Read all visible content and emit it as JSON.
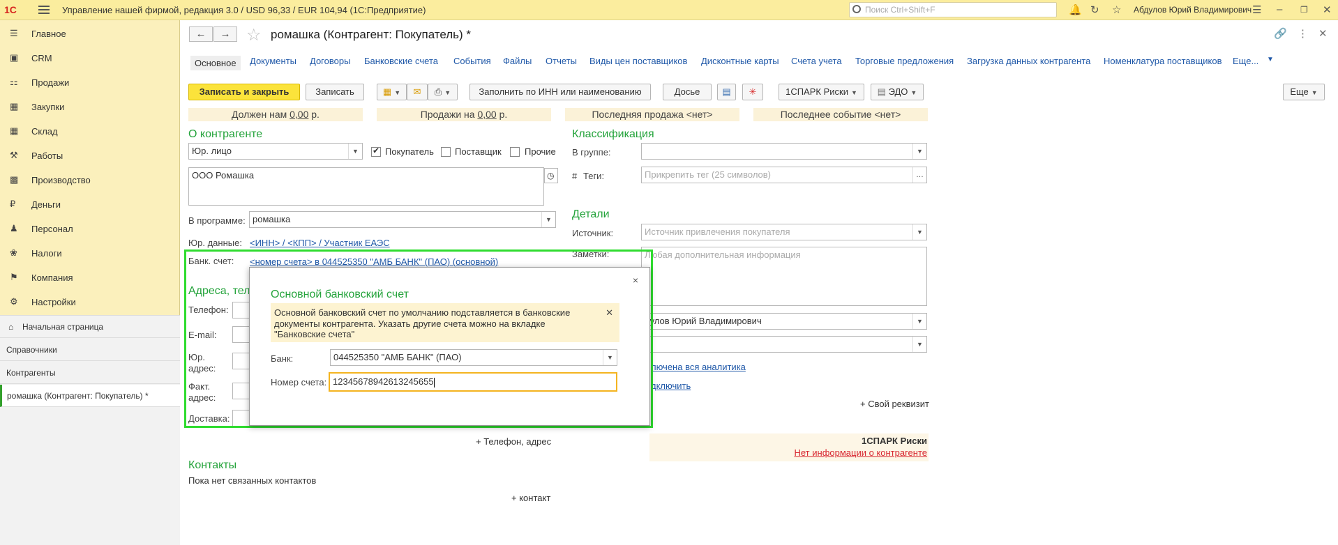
{
  "topbar": {
    "logo": "1С",
    "app_title": "Управление нашей фирмой, редакция 3.0 / USD 96,33 / EUR 104,94  (1С:Предприятие)",
    "search_placeholder": "Поиск Ctrl+Shift+F",
    "user": "Абдулов Юрий Владимирович"
  },
  "sidebar": {
    "sections": [
      {
        "label": "Главное",
        "icon": "menu-icon"
      },
      {
        "label": "CRM",
        "icon": "crm-icon"
      },
      {
        "label": "Продажи",
        "icon": "basket-icon"
      },
      {
        "label": "Закупки",
        "icon": "purchases-icon"
      },
      {
        "label": "Склад",
        "icon": "warehouse-icon"
      },
      {
        "label": "Работы",
        "icon": "tools-icon"
      },
      {
        "label": "Производство",
        "icon": "factory-icon"
      },
      {
        "label": "Деньги",
        "icon": "ruble-icon"
      },
      {
        "label": "Персонал",
        "icon": "people-icon"
      },
      {
        "label": "Налоги",
        "icon": "emblem-icon"
      },
      {
        "label": "Компания",
        "icon": "flag-icon"
      },
      {
        "label": "Настройки",
        "icon": "gear-icon"
      }
    ],
    "open_windows": [
      {
        "label": "Начальная страница"
      },
      {
        "label": "Справочники"
      },
      {
        "label": "Контрагенты"
      },
      {
        "label": "ромашка (Контрагент: Покупатель) *"
      }
    ]
  },
  "header": {
    "back": "←",
    "forward": "→",
    "title": "ромашка (Контрагент: Покупатель) *"
  },
  "tabs": [
    "Основное",
    "Документы",
    "Договоры",
    "Банковские счета",
    "События",
    "Файлы",
    "Отчеты",
    "Виды цен поставщиков",
    "Дисконтные карты",
    "Счета учета",
    "Торговые предложения",
    "Загрузка данных контрагента",
    "Номенклатура поставщиков",
    "Еще..."
  ],
  "toolbar": {
    "save_close": "Записать и закрыть",
    "save": "Записать",
    "fill_inn": "Заполнить по ИНН или наименованию",
    "dossier": "Досье",
    "spark": "1СПАРК Риски",
    "edo": "ЭДО",
    "more": "Еще"
  },
  "summary": {
    "owes_label": "Должен нам",
    "owes_value": "0,00",
    "sales_label": "Продажи на",
    "sales_value": "0,00",
    "currency": "р.",
    "last_sale": "Последняя продажа <нет>",
    "last_event": "Последнее событие <нет>"
  },
  "about": {
    "title": "О контрагенте",
    "entity_type": "Юр. лицо",
    "cb_buyer": "Покупатель",
    "cb_supplier": "Поставщик",
    "cb_other": "Прочие",
    "full_name": "ООО Ромашка",
    "in_program_label": "В программе:",
    "in_program_value": "ромашка",
    "legal_label": "Юр. данные:",
    "legal_link": "<ИНН> / <КПП> / Участник ЕАЭС",
    "bank_label": "Банк. счет:",
    "bank_link": "<номер счета> в 044525350 \"АМБ БАНК\" (ПАО) (основной)"
  },
  "addresses": {
    "title": "Адреса, тел",
    "phone": "Телефон:",
    "email": "E-mail:",
    "legal_addr_1": "Юр.",
    "legal_addr_2": "адрес:",
    "fact_addr_1": "Факт.",
    "fact_addr_2": "адрес:",
    "delivery": "Доставка:",
    "add_phone": "+ Телефон, адрес"
  },
  "contacts": {
    "title": "Контакты",
    "empty": "Пока нет связанных контактов",
    "add": "+ контакт"
  },
  "classification": {
    "title": "Классификация",
    "group_label": "В группе:",
    "tags_hash": "#",
    "tags_label": "Теги:",
    "tags_placeholder": "Прикрепить тег (25 символов)"
  },
  "details": {
    "title": "Детали",
    "source_label": "Источник:",
    "source_placeholder": "Источник привлечения покупателя",
    "notes_label": "Заметки:",
    "notes_placeholder": "Любая дополнительная информация",
    "responsible_value": "дулов Юрий Владимирович",
    "analytics_link": "лючена вся аналитика",
    "connect_link": "дключить",
    "own_attr": "+ Свой реквизит",
    "spark_title": "1СПАРК Риски",
    "spark_link": "Нет информации о контрагенте"
  },
  "dialog": {
    "title": "Основной банковский счет",
    "note": "Основной банковский счет по умолчанию подставляется в банковские документы контрагента. Указать другие счета можно на вкладке \"Банковские счета\"",
    "bank_label": "Банк:",
    "bank_value": "044525350 \"АМБ БАНК\" (ПАО)",
    "account_label": "Номер счета:",
    "account_value": "12345678942613245655",
    "close": "×"
  },
  "colors": {
    "topbar": "#fbed9e",
    "sidebar": "#fbf0bc",
    "accent_green": "#24a33b",
    "link_blue": "#1f58a8",
    "primary_button": "#fbe33b",
    "highlight_frame": "#2fdc2f"
  }
}
